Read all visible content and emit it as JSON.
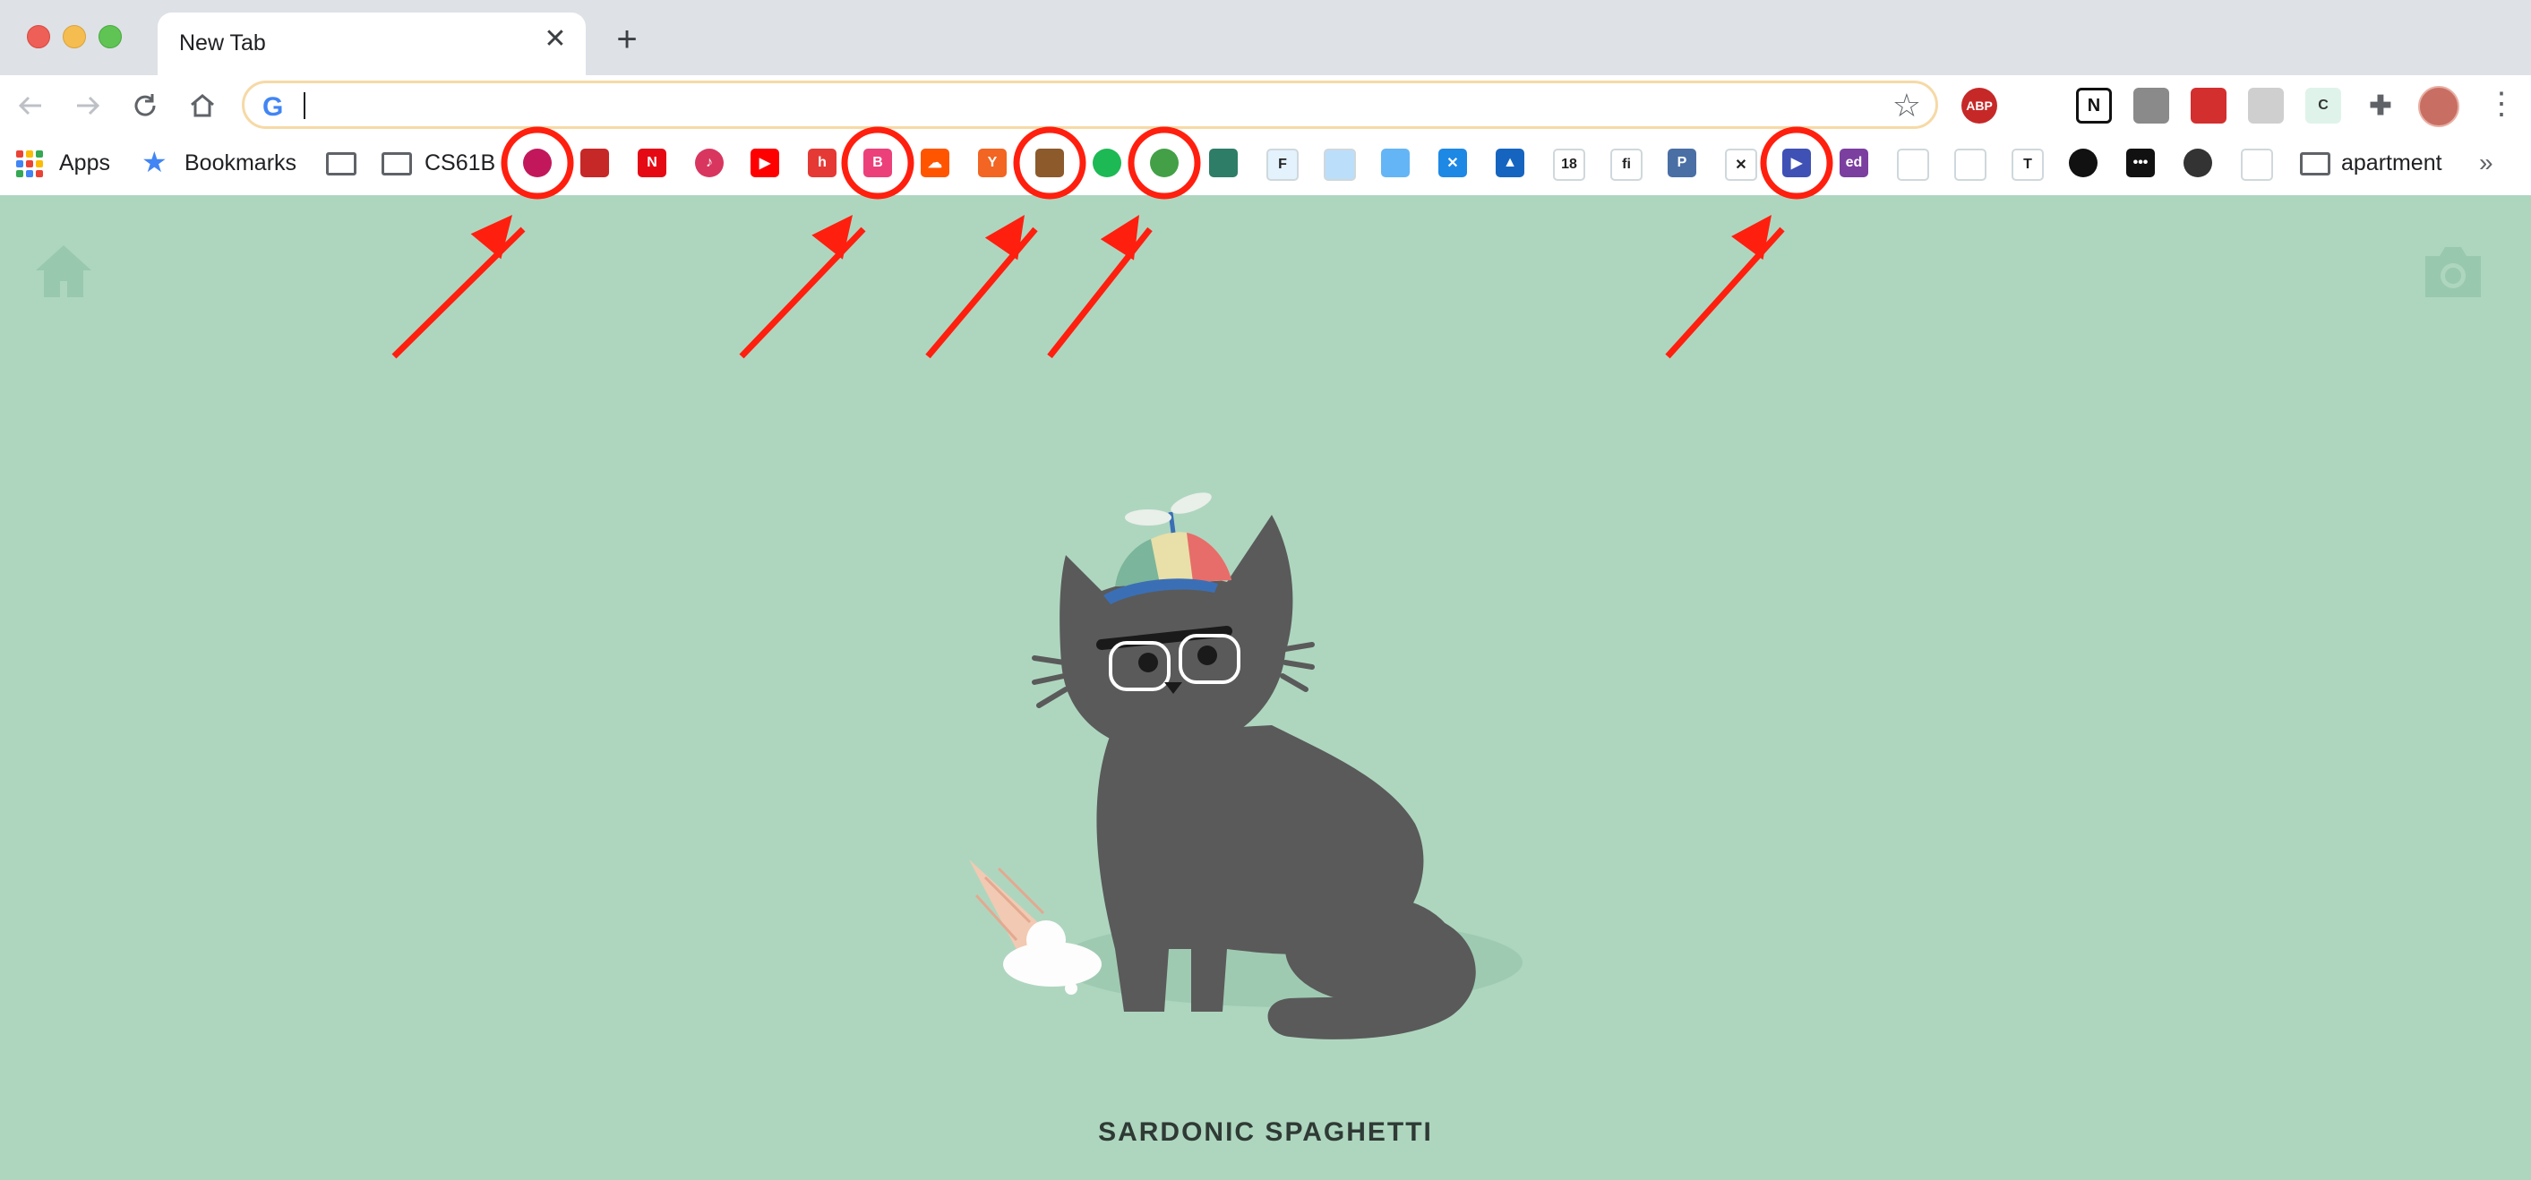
{
  "browser": {
    "tab": {
      "title": "New Tab",
      "close_glyph": "✕"
    },
    "new_tab_glyph": "+",
    "omnibox": {
      "value": "",
      "g_glyph": "G"
    },
    "extensions": [
      {
        "name": "adblock-plus-icon",
        "label": "ABP",
        "color": "#c62828"
      },
      {
        "name": "rainbow-extension-icon",
        "label": "",
        "color": "#ffffff"
      },
      {
        "name": "notion-icon",
        "label": "N",
        "color": "#111111"
      },
      {
        "name": "shield-extension-icon",
        "label": "",
        "color": "#8a8a8a"
      },
      {
        "name": "redirect-arrow-icon",
        "label": "",
        "color": "#d32f2f"
      },
      {
        "name": "grey-square-extension-icon",
        "label": "",
        "color": "#cfcfcf"
      },
      {
        "name": "c-extension-icon",
        "label": "C",
        "color": "#dff3ea"
      },
      {
        "name": "puzzle-extensions-icon",
        "label": "",
        "color": "#5f6368"
      }
    ]
  },
  "bookmarks": {
    "apps_label": "Apps",
    "bookmarks_label": "Bookmarks",
    "cs61b_label": "CS61B",
    "apartment_label": "apartment",
    "more_glyph": "»",
    "icons": [
      {
        "name": "lens-bookmark-icon",
        "label": "",
        "color": "#c2185b",
        "circled": true
      },
      {
        "name": "arrow-bookmark-icon",
        "label": "",
        "color": "#c62828",
        "circled": false
      },
      {
        "name": "netflix-icon",
        "label": "N",
        "color": "#e50914",
        "circled": false
      },
      {
        "name": "music-note-bookmark-icon",
        "label": "♪",
        "color": "#d8365f",
        "circled": false
      },
      {
        "name": "youtube-icon",
        "label": "▶",
        "color": "#ff0000",
        "circled": false
      },
      {
        "name": "handshake-bookmark-icon",
        "label": "h",
        "color": "#e53935",
        "circled": false
      },
      {
        "name": "b-gradient-bookmark-icon",
        "label": "B",
        "color": "#ec407a",
        "circled": true
      },
      {
        "name": "soundcloud-icon",
        "label": "☁",
        "color": "#ff5500",
        "circled": false
      },
      {
        "name": "ycombinator-icon",
        "label": "Y",
        "color": "#f26522",
        "circled": false
      },
      {
        "name": "cake-bookmark-icon",
        "label": "",
        "color": "#8d5a2b",
        "circled": true
      },
      {
        "name": "spotify-green-icon",
        "label": "",
        "color": "#1db954",
        "circled": false
      },
      {
        "name": "green-ring-bookmark-icon",
        "label": "",
        "color": "#43a047",
        "circled": true
      },
      {
        "name": "layers-bookmark-icon",
        "label": "",
        "color": "#2e7d67",
        "circled": false
      },
      {
        "name": "f-bookmark-icon",
        "label": "F",
        "color": "#e3f2fd",
        "circled": false
      },
      {
        "name": "building-bookmark-icon",
        "label": "",
        "color": "#bbdefb",
        "circled": false
      },
      {
        "name": "calendar-blue-bookmark-icon",
        "label": "",
        "color": "#64b5f6",
        "circled": false
      },
      {
        "name": "x-blue-bookmark-icon",
        "label": "✕",
        "color": "#1e88e5",
        "circled": false
      },
      {
        "name": "arrow-up-bookmark-icon",
        "label": "▲",
        "color": "#1565c0",
        "circled": false
      },
      {
        "name": "google-calendar-icon",
        "label": "18",
        "color": "#ffffff",
        "circled": false
      },
      {
        "name": "fi-bookmark-icon",
        "label": "fi",
        "color": "#ffffff",
        "circled": false
      },
      {
        "name": "p-bookmark-icon",
        "label": "P",
        "color": "#4a6fa5",
        "circled": false
      },
      {
        "name": "x-black-bookmark-icon",
        "label": "✕",
        "color": "#ffffff",
        "circled": false
      },
      {
        "name": "video-bookmark-icon",
        "label": "▶",
        "color": "#3f51b5",
        "circled": true
      },
      {
        "name": "ed-bookmark-icon",
        "label": "ed",
        "color": "#7b3fa0",
        "circled": false
      },
      {
        "name": "creative-cloud-icon",
        "label": "",
        "color": "#ffffff",
        "circled": false
      },
      {
        "name": "face-sketch-bookmark-icon",
        "label": "",
        "color": "#ffffff",
        "circled": false
      },
      {
        "name": "nytimes-icon",
        "label": "T",
        "color": "#ffffff",
        "circled": false
      },
      {
        "name": "spotify-black-icon",
        "label": "",
        "color": "#111111",
        "circled": false
      },
      {
        "name": "dots-bookmark-icon",
        "label": "•••",
        "color": "#111111",
        "circled": false
      },
      {
        "name": "globe-bookmark-icon",
        "label": "",
        "color": "#333333",
        "circled": false
      },
      {
        "name": "book-bookmark-icon",
        "label": "",
        "color": "#ffffff",
        "circled": false
      }
    ]
  },
  "page": {
    "caption": "SARDONIC SPAGHETTI",
    "background": "#aed6bf"
  },
  "annotations": {
    "color": "#ff1f0f",
    "circled_count": 5,
    "arrow_count": 5
  }
}
